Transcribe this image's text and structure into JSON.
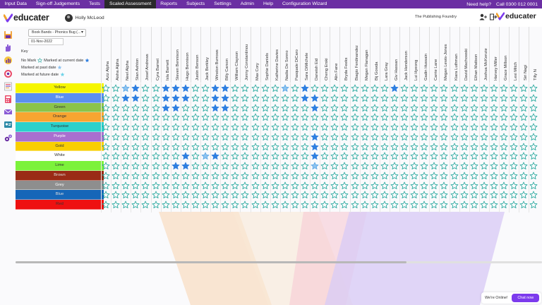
{
  "nav": {
    "items": [
      "Input Data",
      "Sign-off Judgements",
      "Tests",
      "Scaled Assessment",
      "Reports",
      "Subjects",
      "Settings",
      "Admin",
      "Help",
      "Configuration Wizard"
    ],
    "active_index": 3,
    "help": "Need help?",
    "phone": "Call 0300 012 0001"
  },
  "header": {
    "logo_text": "educater",
    "user_name": "Holly McLeod",
    "org": "The Publishing Foundry",
    "logo2_text": "educater"
  },
  "controls": {
    "assessment": "Book Bands - Phonics Bug (...",
    "date": "01-Nov-2022"
  },
  "key": {
    "title": "Key",
    "no_mark": "No Mark",
    "current": "Marked at current date",
    "past": "Marked at past date",
    "future": "Marked at future date"
  },
  "bands": [
    {
      "name": "Yellow",
      "color": "#f6f600",
      "text": "#333"
    },
    {
      "name": "Blue",
      "color": "#5b8ff0",
      "text": "#fff"
    },
    {
      "name": "Green",
      "color": "#8bc34a",
      "text": "#333"
    },
    {
      "name": "Orange",
      "color": "#f7a531",
      "text": "#333"
    },
    {
      "name": "Turquoise",
      "color": "#2bd1cc",
      "text": "#333"
    },
    {
      "name": "Purple",
      "color": "#a96fcf",
      "text": "#fff"
    },
    {
      "name": "Gold",
      "color": "#f9cf00",
      "text": "#333"
    },
    {
      "name": "White",
      "color": "#ffffff",
      "text": "#333"
    },
    {
      "name": "Lime",
      "color": "#7cf23b",
      "text": "#333"
    },
    {
      "name": "Brown",
      "color": "#9a2b16",
      "text": "#ddd"
    },
    {
      "name": "Grey",
      "color": "#8e8e8e",
      "text": "#fff"
    },
    {
      "name": "Blue",
      "color": "#1666b8",
      "text": "#ddd"
    },
    {
      "name": "Red",
      "color": "#ee1111",
      "text": "#333"
    }
  ],
  "students": [
    "Aziz Alpha",
    "Aisha Alpha",
    "Neel Alpha",
    "Stan Ashton",
    "Josef Andrews",
    "Cyra Barnet",
    "Isla Barnett",
    "Steven Bennison",
    "Hugo Bennison",
    "Justin Benson",
    "Jack Berkley",
    "Winston Burrows",
    "Billy Carson",
    "William Clayson",
    "Jonny Constantinou",
    "Max Cory",
    "Sophie Daniels",
    "Katherine Davies",
    "Nadia De Sonno",
    "Pasquale DiCaro",
    "Sara DiMichele",
    "Daneish Eid",
    "Cheng Erski",
    "Alin Fane",
    "Bryda Feeks",
    "Biagio Ferdinandez",
    "Megan Flanagan",
    "Bij Gowda",
    "Lara Gray",
    "Giv Hassan",
    "Jack Henderson",
    "Lui Hyeong",
    "Gadin Hussain",
    "Carrie Lane",
    "Megan Lewis-Jones",
    "Kiara Luthman",
    "David Machowski",
    "Ethan Mattson",
    "Joshua McKenzie",
    "Harvey Miller",
    "Grace Millson",
    "Lexi Mitch",
    "Siri Nagi",
    "Tilly N"
  ],
  "marks_current": [
    [
      0,
      3
    ],
    [
      1,
      3
    ],
    [
      1,
      2
    ],
    [
      0,
      6
    ],
    [
      0,
      7
    ],
    [
      1,
      6
    ],
    [
      1,
      7
    ],
    [
      2,
      7
    ],
    [
      0,
      8
    ],
    [
      1,
      8
    ],
    [
      2,
      6
    ],
    [
      0,
      11
    ],
    [
      0,
      12
    ],
    [
      1,
      11
    ],
    [
      1,
      12
    ],
    [
      2,
      11
    ],
    [
      2,
      12
    ],
    [
      7,
      8
    ],
    [
      7,
      11
    ],
    [
      0,
      20
    ],
    [
      1,
      20
    ],
    [
      1,
      21
    ],
    [
      2,
      21
    ],
    [
      5,
      21
    ],
    [
      6,
      21
    ],
    [
      7,
      21
    ],
    [
      8,
      7
    ],
    [
      8,
      8
    ],
    [
      0,
      29
    ]
  ],
  "marks_past": [
    [
      0,
      2
    ],
    [
      7,
      10
    ],
    [
      0,
      18
    ],
    [
      8,
      21
    ]
  ],
  "colors": {
    "star_outline": "#1fa59a",
    "star_current": "#2f7fe0",
    "nav": "#6b2fa3",
    "accent": "#7c3aed"
  },
  "chat": {
    "online": "We're Online!",
    "button": "Chat now"
  }
}
